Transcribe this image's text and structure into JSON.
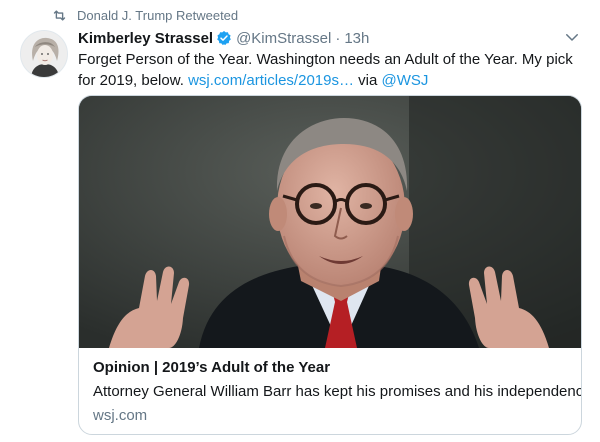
{
  "retweet": {
    "icon": "retweet-icon",
    "text": "Donald J. Trump Retweeted"
  },
  "author": {
    "display_name": "Kimberley Strassel",
    "verified_icon": "verified-badge-icon",
    "handle": "@KimStrassel",
    "separator": "·",
    "time": "13h"
  },
  "tweet": {
    "text_before": "Forget Person of the Year. Washington needs an Adult of the Year. My pick for 2019, below. ",
    "link": "wsj.com/articles/2019s…",
    "via": " via ",
    "mention": "@WSJ"
  },
  "card": {
    "title": "Opinion | 2019’s Adult of the Year",
    "description": "Attorney General William Barr has kept his promises and his independence.",
    "domain": "wsj.com"
  },
  "colors": {
    "link": "#1b95e0",
    "verified": "#1da1f2",
    "secondary_text": "#657786",
    "tie": "#b51f24"
  }
}
